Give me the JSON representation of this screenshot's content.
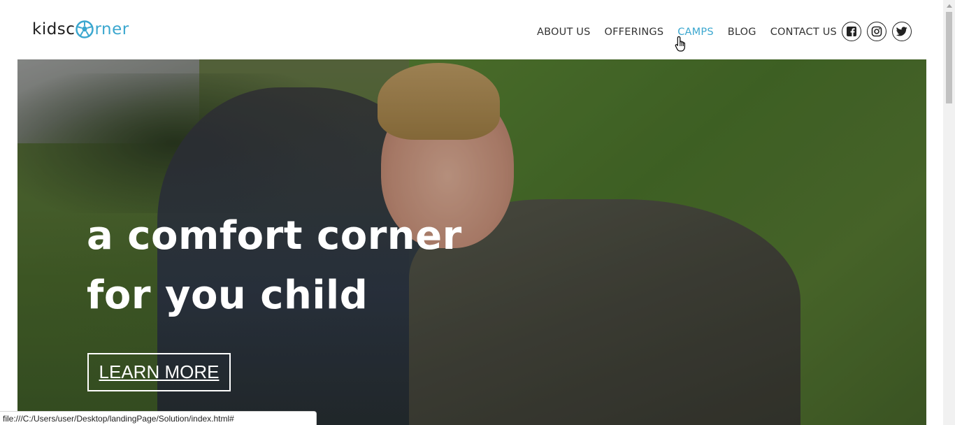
{
  "logo": {
    "prefix": "kidsc",
    "suffix": "rner"
  },
  "nav": [
    {
      "label": "ABOUT US"
    },
    {
      "label": "OFFERINGS"
    },
    {
      "label": "CAMPS"
    },
    {
      "label": "BLOG"
    },
    {
      "label": "CONTACT US"
    }
  ],
  "active_nav": "CAMPS",
  "social": [
    "facebook-icon",
    "instagram-icon",
    "twitter-icon"
  ],
  "hero": {
    "line1": "a comfort corner",
    "line2": "for you child",
    "cta": "LEARN MORE"
  },
  "status_url": "file:///C:/Users/user/Desktop/landingPage/Solution/index.html#",
  "colors": {
    "accent": "#3ba7cf",
    "text": "#333333"
  }
}
